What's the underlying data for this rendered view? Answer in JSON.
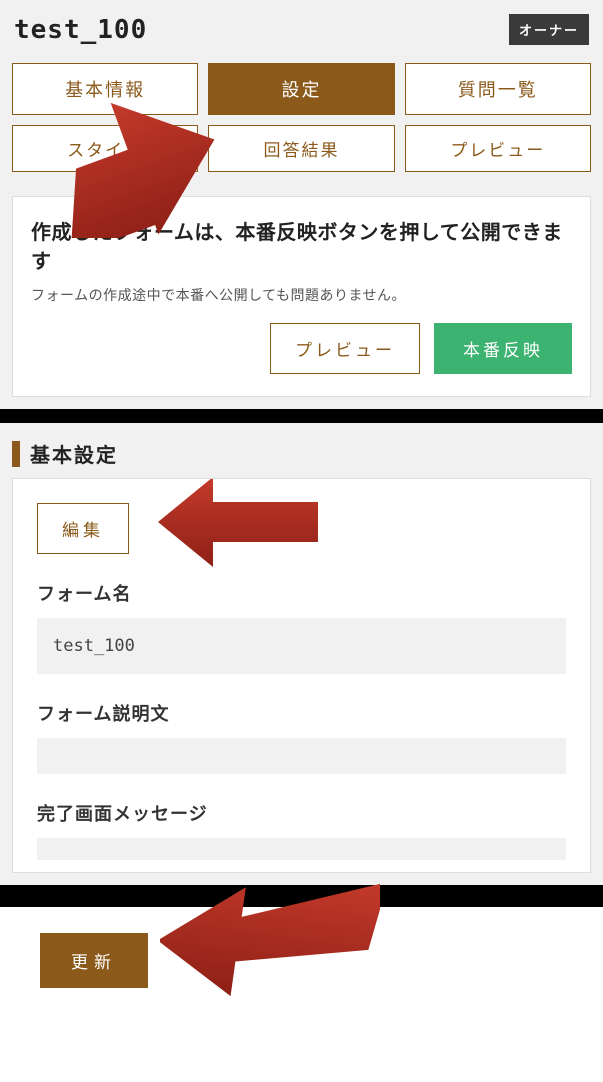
{
  "header": {
    "title": "test_100",
    "owner_badge": "オーナー"
  },
  "tabs": {
    "row1": [
      {
        "label": "基本情報",
        "active": false
      },
      {
        "label": "設定",
        "active": true
      },
      {
        "label": "質問一覧",
        "active": false
      }
    ],
    "row2": [
      {
        "label": "スタイル",
        "active": false
      },
      {
        "label": "回答結果",
        "active": false
      },
      {
        "label": "プレビュー",
        "active": false
      }
    ]
  },
  "notice": {
    "title": "作成したフォームは、本番反映ボタンを押して公開できます",
    "subtitle": "フォームの作成途中で本番へ公開しても問題ありません。",
    "preview_label": "プレビュー",
    "publish_label": "本番反映"
  },
  "settings_section": {
    "title": "基本設定",
    "edit_label": "編集",
    "fields": {
      "name_label": "フォーム名",
      "name_value": "test_100",
      "desc_label": "フォーム説明文",
      "desc_value": "",
      "complete_label": "完了画面メッセージ",
      "complete_value": ""
    }
  },
  "footer": {
    "update_label": "更新"
  }
}
